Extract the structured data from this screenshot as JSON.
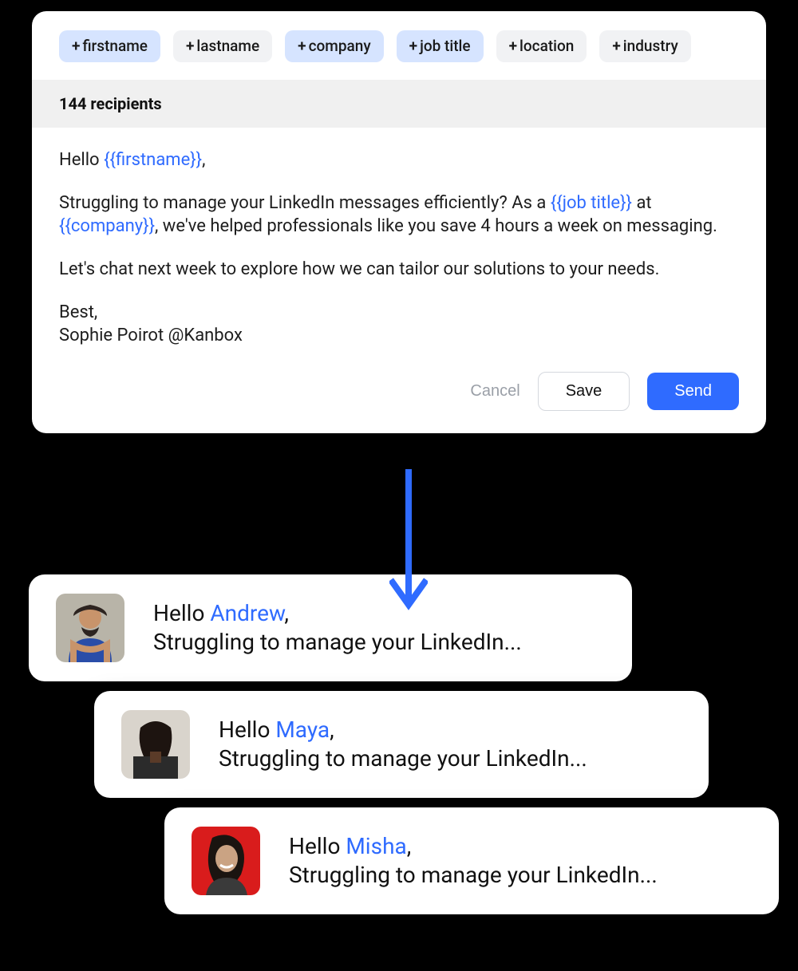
{
  "chips": [
    {
      "label": "firstname",
      "selected": true
    },
    {
      "label": "lastname",
      "selected": false
    },
    {
      "label": "company",
      "selected": true
    },
    {
      "label": "job title",
      "selected": true
    },
    {
      "label": "location",
      "selected": false
    },
    {
      "label": "industry",
      "selected": false
    }
  ],
  "recipients_label": "144 recipients",
  "message": {
    "greeting_prefix": "Hello ",
    "greeting_token": "{{firstname}}",
    "greeting_suffix": ",",
    "para2_part1": "Struggling to manage your LinkedIn messages efficiently? As a ",
    "para2_token1": "{{job title}}",
    "para2_mid": " at ",
    "para2_token2": "{{company}}",
    "para2_part2": ", we've helped professionals like you save 4 hours a week on messaging.",
    "para3": "Let's chat next week to explore how we can tailor our solutions to your needs.",
    "signoff1": "Best,",
    "signoff2": "Sophie Poirot @Kanbox"
  },
  "actions": {
    "cancel": "Cancel",
    "save": "Save",
    "send": "Send"
  },
  "previews": [
    {
      "greeting_prefix": "Hello ",
      "name": "Andrew",
      "greeting_suffix": ",",
      "line2": "Struggling to manage your LinkedIn..."
    },
    {
      "greeting_prefix": "Hello ",
      "name": "Maya",
      "greeting_suffix": ",",
      "line2": "Struggling to manage your LinkedIn..."
    },
    {
      "greeting_prefix": "Hello ",
      "name": "Misha",
      "greeting_suffix": ",",
      "line2": "Struggling to manage your LinkedIn..."
    }
  ]
}
